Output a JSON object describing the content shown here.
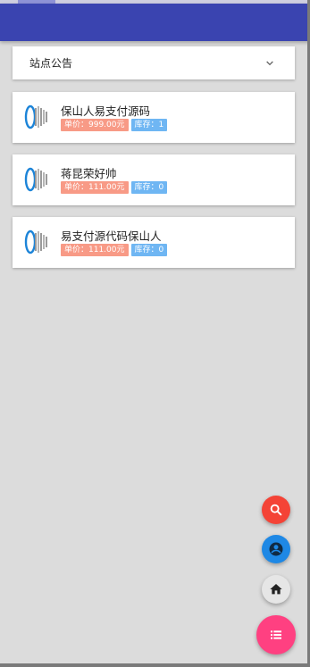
{
  "notice": {
    "title": "站点公告"
  },
  "products": [
    {
      "name": "保山人易支付源码",
      "price": "单价：999.00元",
      "stock": "库存：1"
    },
    {
      "name": "蒋昆荣好帅",
      "price": "单价：111.00元",
      "stock": "库存：0"
    },
    {
      "name": "易支付源代码保山人",
      "price": "单价：111.00元",
      "stock": "库存：0"
    }
  ],
  "fabs": [
    {
      "icon": "search-icon",
      "color": "#f44336"
    },
    {
      "icon": "account-icon",
      "color": "#1e88e5"
    },
    {
      "icon": "home-icon",
      "color": "#e6e6e6"
    },
    {
      "icon": "list-icon",
      "color": "#ff4081"
    }
  ],
  "colors": {
    "appbar": "#3a44b0",
    "background": "#dcdcdc",
    "price_tag": "#f89a86",
    "stock_tag": "#6fb6f3"
  }
}
